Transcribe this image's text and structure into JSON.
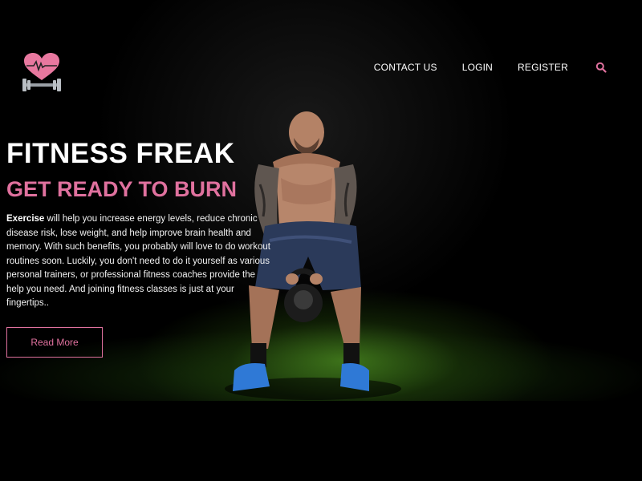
{
  "colors": {
    "accent": "#e0719e",
    "background": "#000000",
    "text": "#ffffff"
  },
  "logo": {
    "icon": "heart-dumbbell-logo-icon"
  },
  "nav": {
    "items": [
      {
        "label": "CONTACT US"
      },
      {
        "label": "LOGIN"
      },
      {
        "label": "REGISTER"
      }
    ],
    "search_icon": "search-icon"
  },
  "hero": {
    "title": "FITNESS FREAK",
    "subtitle": "GET READY TO BURN",
    "desc_bold": "Exercise",
    "desc_rest": " will help you increase energy levels, reduce chronic disease risk, lose weight, and help improve brain health and memory. With such benefits, you probably will love to do workout routines soon. Luckily, you don't need to do it yourself as various personal trainers, or professional fitness coaches provide the help you need. And joining fitness classes is just at your fingertips..",
    "cta_label": "Read More",
    "image": "athlete-kettlebell-swing"
  }
}
